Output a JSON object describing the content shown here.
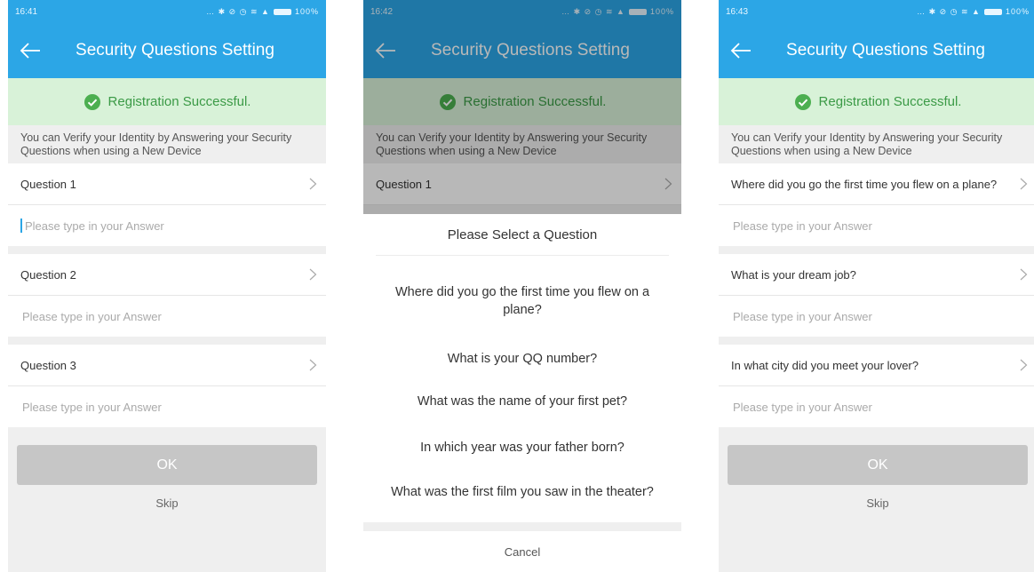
{
  "colors": {
    "accent": "#2ca6e6",
    "success_bg": "#d8f2d8",
    "success_text": "#3b9a46",
    "ok_disabled": "#c6c6c6"
  },
  "screens": [
    {
      "time": "16:41",
      "status_icons": "… ✱ ⊘ ◷ ≋ ▲",
      "battery": "100%",
      "title": "Security Questions Setting",
      "success": "Registration Successful.",
      "info_line1": "You can Verify your Identity by Answering your Security",
      "info_line2": "Questions when using a New Device",
      "questions": [
        "Question 1",
        "Question 2",
        "Question 3"
      ],
      "answer_placeholder": "Please type in your Answer",
      "ok": "OK",
      "skip": "Skip"
    },
    {
      "time": "16:42",
      "status_icons": "… ✱ ⊘ ◷ ≋ ▲",
      "battery": "100%",
      "title": "Security Questions Setting",
      "success": "Registration Successful.",
      "info_line1": "You can Verify your Identity by Answering your Security",
      "info_line2": "Questions when using a New Device",
      "question1": "Question 1",
      "sheet_title": "Please Select a Question",
      "options": [
        "Where did you go the first time you flew on a",
        "plane?",
        "What is your QQ number?",
        "What was the name of your first pet?",
        "In which year was your father born?",
        "What was the first film you saw in the theater?"
      ],
      "cancel": "Cancel"
    },
    {
      "time": "16:43",
      "status_icons": "… ✱ ⊘ ◷ ≋ ▲",
      "battery": "100%",
      "title": "Security Questions Setting",
      "success": "Registration Successful.",
      "info_line1": "You can Verify your Identity by Answering your Security",
      "info_line2": "Questions when using a New Device",
      "questions": [
        "Where did you go the first time you flew on a plane?",
        "What is your dream job?",
        "In what city did you meet your lover?"
      ],
      "answer_placeholder": "Please type in your Answer",
      "ok": "OK",
      "skip": "Skip"
    }
  ]
}
